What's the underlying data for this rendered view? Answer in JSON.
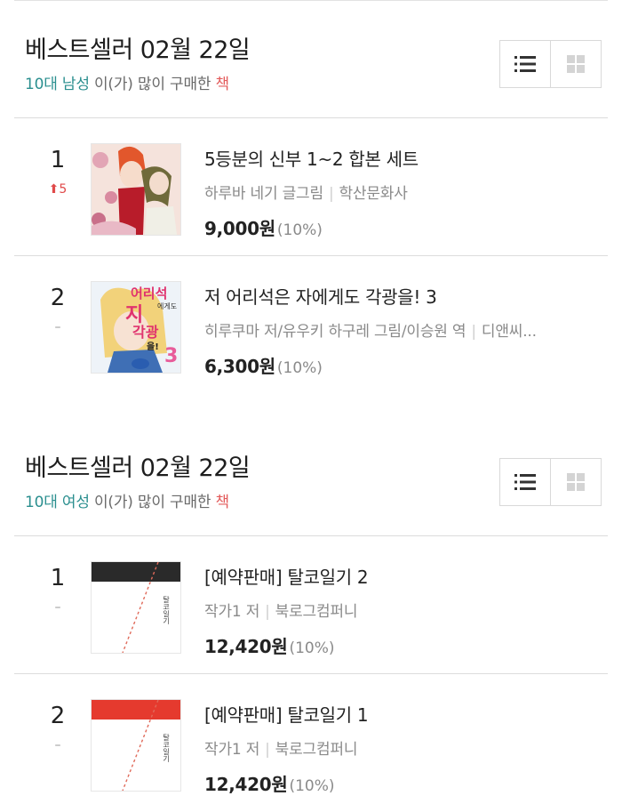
{
  "sections": [
    {
      "title": "베스트셀러 02월 22일",
      "subtitle": {
        "demo": "10대 남성",
        "mid": " 이(가) 많이 구매한 ",
        "accent": "책"
      },
      "items": [
        {
          "rank": "1",
          "change": "⬆5",
          "title": "5등분의 신부 1~2 합본 세트",
          "author": "하루바 네기 글그림",
          "publisher": "학산문화사",
          "price": "9,000원",
          "discount": "(10%)"
        },
        {
          "rank": "2",
          "change": "–",
          "title": "저 어리석은 자에게도 각광을! 3",
          "author": "히루쿠마 저/유우키 하구레 그림/이승원 역",
          "publisher": "디앤씨...",
          "price": "6,300원",
          "discount": "(10%)"
        }
      ]
    },
    {
      "title": "베스트셀러 02월 22일",
      "subtitle": {
        "demo": "10대 여성",
        "mid": " 이(가) 많이 구매한 ",
        "accent": "책"
      },
      "items": [
        {
          "rank": "1",
          "change": "–",
          "title": "[예약판매] 탈코일기 2",
          "author": "작가1 저",
          "publisher": "북로그컴퍼니",
          "price": "12,420원",
          "discount": "(10%)"
        },
        {
          "rank": "2",
          "change": "–",
          "title": "[예약판매] 탈코일기 1",
          "author": "작가1 저",
          "publisher": "북로그컴퍼니",
          "price": "12,420원",
          "discount": "(10%)"
        }
      ]
    }
  ],
  "cover_texts": {
    "s0i1": {
      "line1": "어리석",
      "line2": "에게도",
      "line3": "지",
      "line4": "각광",
      "line5": "을!",
      "volume": "3"
    },
    "s1i0": {
      "vertical": "탈코일기"
    },
    "s1i1": {
      "vertical": "탈코일기"
    }
  },
  "icons": {
    "list_view": "list-icon",
    "grid_view": "grid-icon",
    "rank_up": "arrow-up-icon"
  },
  "colors": {
    "subtitle_demo": "#2b8f8f",
    "subtitle_accent": "#e35c5c",
    "rank_up": "#e04a4a",
    "cover_band_2": "#2a2a2a",
    "cover_band_1": "#e53a2e"
  }
}
